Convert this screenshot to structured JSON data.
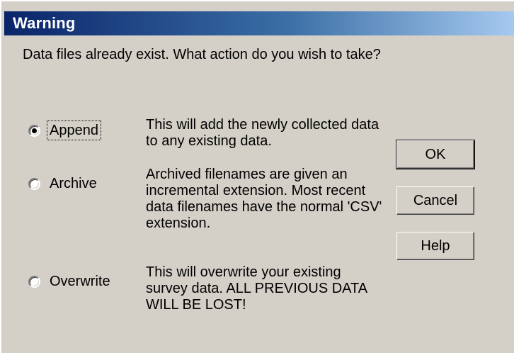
{
  "dialog": {
    "title": "Warning",
    "prompt": "Data files already exist. What action do you wish to take?",
    "options": [
      {
        "label": "Append",
        "selected": true,
        "description": "This will add the newly collected data to any existing data."
      },
      {
        "label": "Archive",
        "selected": false,
        "description": "Archived filenames are given an incremental extension. Most recent data filenames have the normal 'CSV' extension."
      },
      {
        "label": "Overwrite",
        "selected": false,
        "description": "This will overwrite your existing survey data. ALL PREVIOUS DATA WILL BE LOST!"
      }
    ],
    "buttons": {
      "ok": "OK",
      "cancel": "Cancel",
      "help": "Help"
    }
  }
}
